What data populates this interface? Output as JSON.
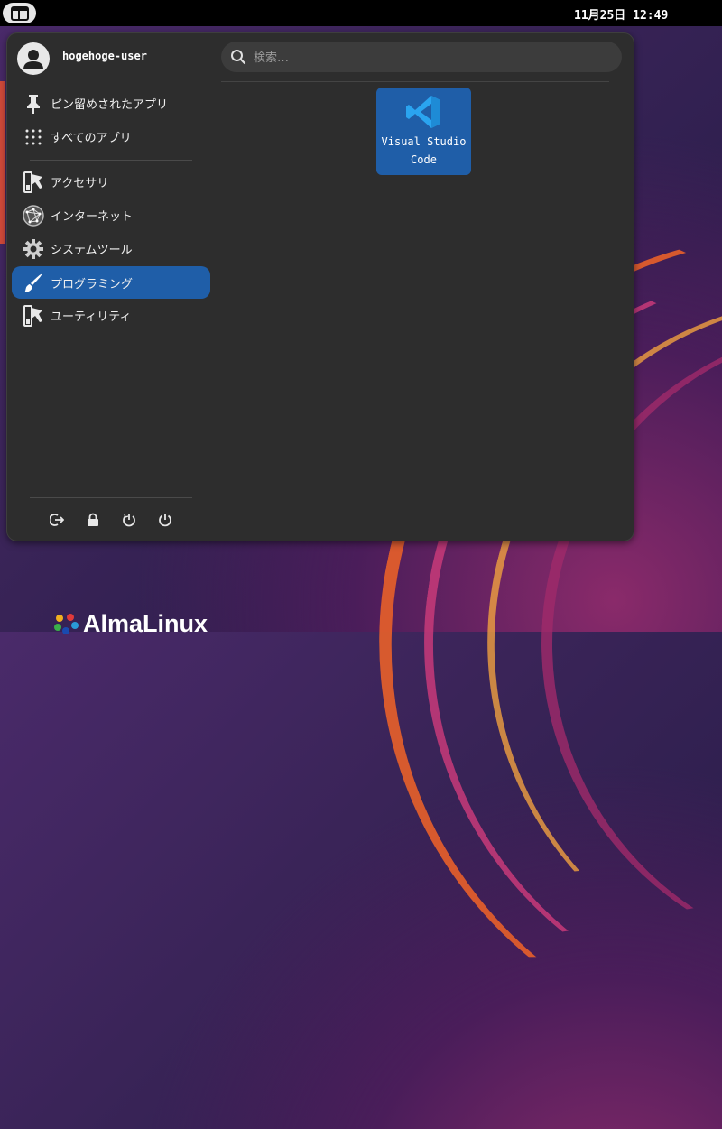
{
  "topbar": {
    "clock": "11月25日 12:49"
  },
  "user": {
    "name": "hogehoge-user"
  },
  "search": {
    "placeholder": "検索…"
  },
  "categories": [
    {
      "label": "ピン留めされたアプリ",
      "icon": "pin-icon"
    },
    {
      "label": "すべてのアプリ",
      "icon": "grid-icon"
    },
    {
      "label": "アクセサリ",
      "icon": "accessories-icon"
    },
    {
      "label": "インターネット",
      "icon": "internet-icon"
    },
    {
      "label": "システムツール",
      "icon": "gear-icon"
    },
    {
      "label": "プログラミング",
      "icon": "brush-icon",
      "selected": true
    },
    {
      "label": "ユーティリティ",
      "icon": "utilities-icon"
    }
  ],
  "apps": [
    {
      "line1": "Visual Studio",
      "line2": "Code",
      "icon": "vscode-icon"
    }
  ],
  "power": [
    "logout-icon",
    "lock-icon",
    "restart-icon",
    "power-icon"
  ],
  "wallpaper": {
    "logo_text": "AlmaLinux"
  },
  "colors": {
    "accent": "#1f5ea8",
    "menu_bg": "#2d2d2d",
    "vscode": "#2aa4f0"
  }
}
